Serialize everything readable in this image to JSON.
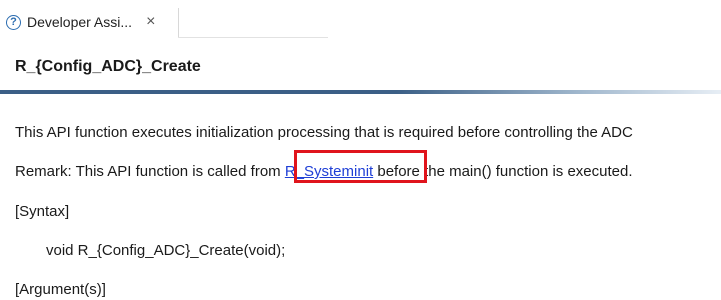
{
  "tab": {
    "title": "Developer Assi...",
    "help_glyph": "?",
    "close_glyph": "×"
  },
  "page": {
    "title": "R_{Config_ADC}_Create",
    "description": "This API function executes initialization processing that is required before controlling the ADC",
    "remark_prefix": "Remark: This API function is called from ",
    "remark_link": "R_Systeminit",
    "remark_suffix": " before the main() function is executed.",
    "syntax_heading": "[Syntax]",
    "syntax_code": "void R_{Config_ADC}_Create(void);",
    "arguments_heading": "[Argument(s)]"
  },
  "colors": {
    "link": "#1f3fd6",
    "highlight": "#e0141c",
    "title_rule": "#3b5f86"
  }
}
